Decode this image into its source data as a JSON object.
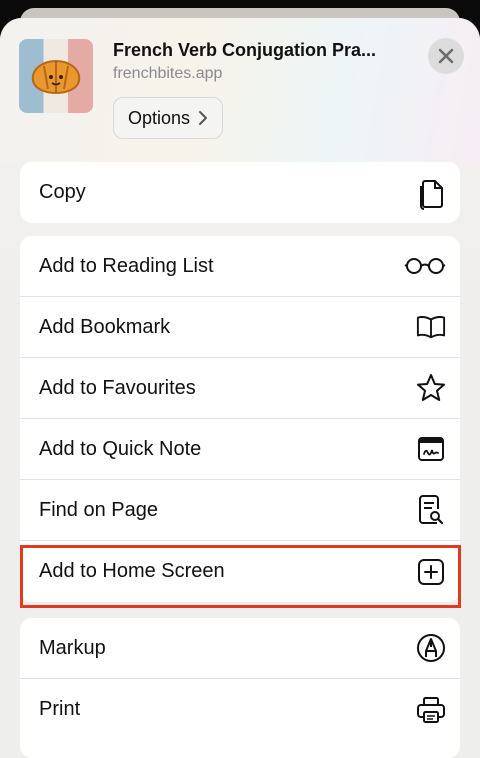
{
  "header": {
    "title": "French Verb Conjugation Pra...",
    "domain": "frenchbites.app",
    "options_label": "Options",
    "app_icon": "croissant-flag-icon"
  },
  "groups": [
    {
      "items": [
        {
          "label": "Copy",
          "icon": "copy-icon"
        }
      ]
    },
    {
      "items": [
        {
          "label": "Add to Reading List",
          "icon": "glasses-icon"
        },
        {
          "label": "Add Bookmark",
          "icon": "book-icon"
        },
        {
          "label": "Add to Favourites",
          "icon": "star-icon"
        },
        {
          "label": "Add to Quick Note",
          "icon": "quick-note-icon"
        },
        {
          "label": "Find on Page",
          "icon": "find-on-page-icon"
        },
        {
          "label": "Add to Home Screen",
          "icon": "plus-square-icon",
          "highlighted": true
        }
      ]
    },
    {
      "items": [
        {
          "label": "Markup",
          "icon": "markup-pen-icon"
        },
        {
          "label": "Print",
          "icon": "printer-icon"
        }
      ]
    }
  ],
  "colors": {
    "highlight": "#e23a1f",
    "sheet_bg": "#efeeec",
    "row_bg": "#ffffff"
  }
}
